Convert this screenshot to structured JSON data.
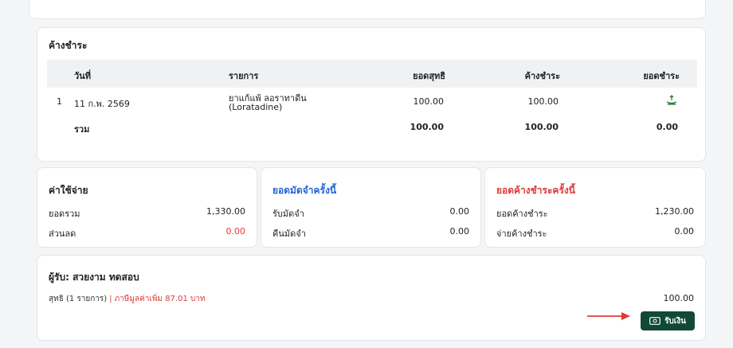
{
  "outstanding": {
    "title": "ค้างชำระ",
    "headers": {
      "date": "วันที่",
      "item": "รายการ",
      "net": "ยอดสุทธิ",
      "due": "ค้างชำระ",
      "pay": "ยอดชำระ"
    },
    "rows": [
      {
        "no": "1",
        "date": "11 ก.พ. 2569",
        "item_line1": "ยาแก้แพ้ ลอราทาดีน",
        "item_line2": "(Loratadine)",
        "net": "100.00",
        "due": "100.00",
        "pay_icon": "cash-icon"
      }
    ],
    "total": {
      "label": "รวม",
      "net": "100.00",
      "due": "100.00",
      "pay": "0.00"
    }
  },
  "expenses": {
    "title": "ค่าใช้จ่าย",
    "total_label": "ยอดรวม",
    "total_value": "1,330.00",
    "discount_label": "ส่วนลด",
    "discount_value": "0.00"
  },
  "deposit": {
    "title": "ยอดมัดจำครั้งนี้",
    "receive_label": "รับมัดจำ",
    "receive_value": "0.00",
    "refund_label": "คืนมัดจำ",
    "refund_value": "0.00"
  },
  "current_due": {
    "title": "ยอดค้างชำระครั้งนี้",
    "due_label": "ยอดค้างชำระ",
    "due_value": "1,230.00",
    "pay_label": "จ่ายค้างชำระ",
    "pay_value": "0.00"
  },
  "receiver": {
    "title": "ผู้รับ: สวยงาม ทดสอบ",
    "net_label": "สุทธิ (1 รายการ)",
    "separator": "|",
    "vat_text": "ภาษีมูลค่าเพิ่ม 87.01 บาท",
    "net_total": "100.00",
    "button_label": "รับเงิน",
    "button_icon": "cash-icon"
  },
  "colors": {
    "accent_green": "#114a34",
    "red": "#e03a3a",
    "blue": "#2463d6"
  }
}
